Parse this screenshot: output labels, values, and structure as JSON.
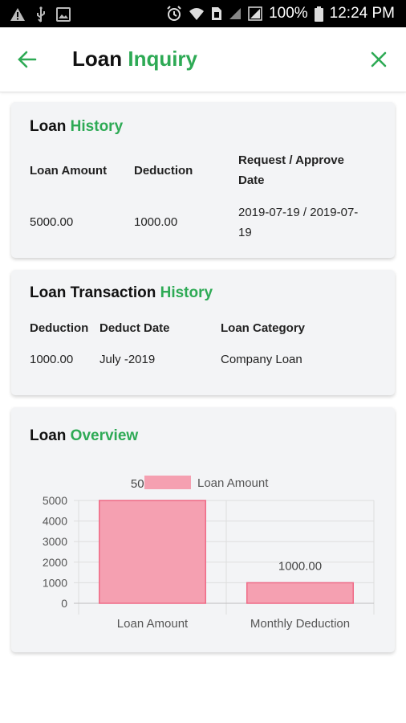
{
  "status_bar": {
    "battery": "100%",
    "time": "12:24 PM"
  },
  "header": {
    "title_part1": "Loan",
    "title_part2": "Inquiry"
  },
  "loan_history": {
    "title_part1": "Loan",
    "title_part2": "History",
    "columns": [
      "Loan Amount",
      "Deduction",
      "Request / Approve",
      "Date"
    ],
    "row": {
      "loan_amount": "5000.00",
      "deduction": "1000.00",
      "date_line1": "2019-07-19 / 2019-07-",
      "date_line2": "19"
    }
  },
  "transaction_history": {
    "title_part1": "Loan Transaction",
    "title_part2": "History",
    "columns": [
      "Deduction",
      "Deduct Date",
      "Loan Category"
    ],
    "row": {
      "deduction": "1000.00",
      "deduct_date": "July -2019",
      "loan_category": "Company Loan"
    }
  },
  "overview": {
    "title_part1": "Loan",
    "title_part2": "Overview"
  },
  "colors": {
    "accent": "#2eaa55",
    "negative": "#e0444d",
    "bar_fill": "#f5a0b1",
    "bar_stroke": "#ef6a86"
  },
  "chart_data": {
    "type": "bar",
    "categories": [
      "Loan Amount",
      "Monthly Deduction"
    ],
    "series": [
      {
        "name": "Loan Amount",
        "values": [
          5000,
          1000
        ]
      }
    ],
    "data_labels": [
      "5000.00",
      "1000.00"
    ],
    "yticks": [
      0,
      1000,
      2000,
      3000,
      4000,
      5000
    ],
    "ylim": [
      0,
      5000
    ],
    "grid": true,
    "legend": "top"
  }
}
